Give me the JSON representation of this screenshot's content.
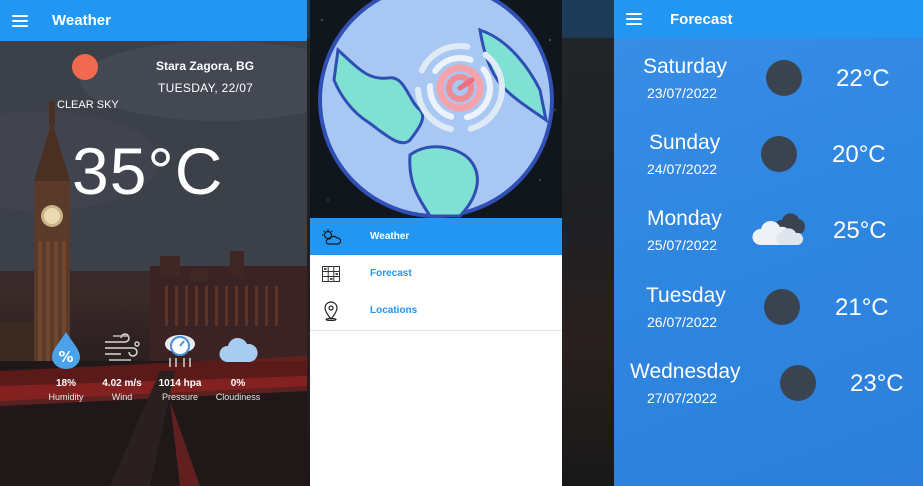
{
  "weather_screen": {
    "title": "Weather",
    "location": "Stara Zagora, BG",
    "date": "TUESDAY, 22/07",
    "condition": "CLEAR SKY",
    "temperature": "35°C",
    "stats": [
      {
        "value": "18%",
        "label": "Humidity",
        "icon": "humidity-drop-icon"
      },
      {
        "value": "4.02 m/s",
        "label": "Wind",
        "icon": "wind-icon"
      },
      {
        "value": "1014 hpa",
        "label": "Pressure",
        "icon": "pressure-gauge-icon"
      },
      {
        "value": "0%",
        "label": "Cloudiness",
        "icon": "cloud-icon"
      }
    ],
    "colors": {
      "appbar": "#2196f3",
      "sun": "#f06a4f"
    }
  },
  "drawer": {
    "menu": [
      {
        "label": "Weather",
        "icon": "partly-cloudy-icon",
        "active": true
      },
      {
        "label": "Forecast",
        "icon": "calendar-grid-icon",
        "active": false
      },
      {
        "label": "Locations",
        "icon": "location-pin-icon",
        "active": false
      }
    ],
    "colors": {
      "accent": "#2196f3",
      "globe_ocean": "#a7c7f2",
      "globe_land": "#7fe0d3"
    }
  },
  "forecast_screen": {
    "title": "Forecast",
    "days": [
      {
        "day": "Saturday",
        "date": "23/07/2022",
        "temp": "22°C",
        "icon": "moon-icon"
      },
      {
        "day": "Sunday",
        "date": "24/07/2022",
        "temp": "20°C",
        "icon": "moon-icon"
      },
      {
        "day": "Monday",
        "date": "25/07/2022",
        "temp": "25°C",
        "icon": "cloudy-icon"
      },
      {
        "day": "Tuesday",
        "date": "26/07/2022",
        "temp": "21°C",
        "icon": "moon-icon"
      },
      {
        "day": "Wednesday",
        "date": "27/07/2022",
        "temp": "23°C",
        "icon": "moon-icon"
      }
    ]
  }
}
